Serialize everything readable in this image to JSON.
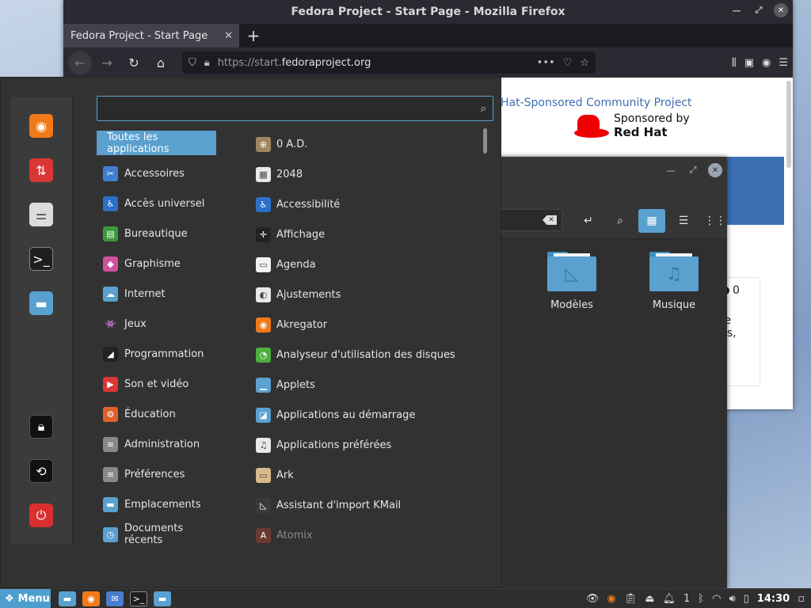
{
  "firefox": {
    "window_title": "Fedora Project - Start Page - Mozilla Firefox",
    "tab_title": "Fedora Project - Start Page",
    "url_prefix": "https://start.",
    "url_domain": "fedoraproject.org",
    "new_tab_symbol": "+",
    "page": {
      "sponsor_heading": "Hat-Sponsored Community Project",
      "sponsored_by": "Sponsored by",
      "redhat": "Red Hat",
      "card_count": "0",
      "card_line1": "re",
      "card_line2": "ds,"
    }
  },
  "file_manager": {
    "folders": [
      {
        "label": "Modèles",
        "glyph": "◺"
      },
      {
        "label": "Musique",
        "glyph": "♫"
      }
    ]
  },
  "menu": {
    "search_placeholder": "",
    "categories": [
      {
        "label": "Toutes les applications",
        "color": "",
        "glyph": ""
      },
      {
        "label": "Accessoires",
        "color": "#3f7fd1",
        "glyph": "✂"
      },
      {
        "label": "Accès universel",
        "color": "#2c6fc9",
        "glyph": "♿"
      },
      {
        "label": "Bureautique",
        "color": "#3a9a3a",
        "glyph": "▤"
      },
      {
        "label": "Graphisme",
        "color": "#d24fa0",
        "glyph": "◆"
      },
      {
        "label": "Internet",
        "color": "#5aa1cf",
        "glyph": "☁"
      },
      {
        "label": "Jeux",
        "color": "#333333",
        "glyph": "👾"
      },
      {
        "label": "Programmation",
        "color": "#222222",
        "glyph": "◢"
      },
      {
        "label": "Son et vidéo",
        "color": "#d93636",
        "glyph": "▶"
      },
      {
        "label": "Éducation",
        "color": "#e0612a",
        "glyph": "⚙"
      },
      {
        "label": "Administration",
        "color": "#888888",
        "glyph": "≡"
      },
      {
        "label": "Préférences",
        "color": "#888888",
        "glyph": "≡"
      },
      {
        "label": "Emplacements",
        "color": "#5aa1cf",
        "glyph": "▬"
      },
      {
        "label": "Documents récents",
        "color": "#5aa1cf",
        "glyph": "◷"
      }
    ],
    "apps": [
      {
        "label": "0 A.D.",
        "color": "#a08660",
        "glyph": "⊕"
      },
      {
        "label": "2048",
        "color": "#e8e8e8",
        "glyph": "▦"
      },
      {
        "label": "Accessibilité",
        "color": "#2c6fc9",
        "glyph": "♿"
      },
      {
        "label": "Affichage",
        "color": "#222222",
        "glyph": "✛"
      },
      {
        "label": "Agenda",
        "color": "#f2f2f2",
        "glyph": "▭"
      },
      {
        "label": "Ajustements",
        "color": "#e8e8e8",
        "glyph": "◐"
      },
      {
        "label": "Akregator",
        "color": "#f07a1a",
        "glyph": "◉"
      },
      {
        "label": "Analyseur d'utilisation des disques",
        "color": "#4fae3e",
        "glyph": "◔"
      },
      {
        "label": "Applets",
        "color": "#5aa1cf",
        "glyph": "▁"
      },
      {
        "label": "Applications au démarrage",
        "color": "#5aa1cf",
        "glyph": "◪"
      },
      {
        "label": "Applications préférées",
        "color": "#e8e8e8",
        "glyph": "♫"
      },
      {
        "label": "Ark",
        "color": "#d8b98a",
        "glyph": "▭"
      },
      {
        "label": "Assistant d'import KMail",
        "color": "#3a3a3a",
        "glyph": "◺"
      },
      {
        "label": "Atomix",
        "color": "#6a3a30",
        "glyph": "A"
      }
    ]
  },
  "panel": {
    "menu_label": "Menu",
    "notification_count": "1",
    "clock": "14:30"
  },
  "colors": {
    "accent": "#5aa1cf",
    "menu_bg": "#323232",
    "firefox_chrome": "#2b2a33"
  }
}
